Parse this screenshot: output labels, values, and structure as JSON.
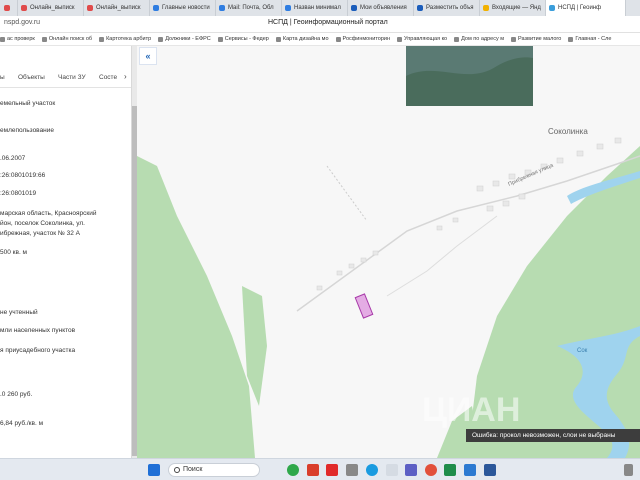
{
  "browser": {
    "tabs": [
      {
        "label": "",
        "color": "#e04b4b"
      },
      {
        "label": "Онлайн_выписк",
        "color": "#e04b4b"
      },
      {
        "label": "Онлайн_выписк",
        "color": "#e04b4b"
      },
      {
        "label": "Главные новости",
        "color": "#2f7de1"
      },
      {
        "label": "Mail: Почта, Обл",
        "color": "#2f7de1"
      },
      {
        "label": "Назван минимал",
        "color": "#2f7de1"
      },
      {
        "label": "Мои объявления",
        "color": "#1b5dbb"
      },
      {
        "label": "Разместить объя",
        "color": "#1b5dbb"
      },
      {
        "label": "Входящие — Янд",
        "color": "#f2b100"
      },
      {
        "label": "НСПД | Геоинф",
        "color": "#3b9edb",
        "active": true
      }
    ],
    "url": "nspd.gov.ru",
    "page_title": "НСПД | Геоинформационный портал",
    "bookmarks": [
      "ас проверк",
      "Онлайн поиск об",
      "Картотека арбитр",
      "Должники - ЕФРС",
      "Сервисы - Федер",
      "Карта дизайна мо",
      "Росфинмониторин",
      "Управляющая ко",
      "Дом по адресу м",
      "Развитие малого",
      "Главная - Сле"
    ]
  },
  "panel": {
    "tabs": [
      "ы",
      "Объекты",
      "Части ЗУ",
      "Состе"
    ],
    "more": "›",
    "rows": [
      {
        "text": "емельный участок"
      },
      {
        "text": "емлепользование"
      },
      {
        "text": ".06.2007"
      },
      {
        "text": ":26:0801019:66"
      },
      {
        "text": ":26:0801019"
      },
      {
        "text": "марская область, Красноярский"
      },
      {
        "text": "йон, поселок Соколинка, ул."
      },
      {
        "text": "ибрежная, участок № 32 А"
      },
      {
        "text": "500 кв. м"
      },
      {
        "text": "не учтенный"
      },
      {
        "text": "мли населенных пунктов"
      },
      {
        "text": "я приусадебного участка"
      },
      {
        "text": ".0 260 руб."
      },
      {
        "text": "6,84 руб./кв. м"
      }
    ]
  },
  "map": {
    "collapse_label": "«",
    "place_name": "Соколинка",
    "street_label": "Прибрежная улица",
    "river_label": "Сок",
    "watermark": "ЦИАН",
    "error_text": "Ошибка: прокол невозможен, слои не выбраны",
    "colors": {
      "forest": "#b7dcb1",
      "forest_dark": "#a8d3a2",
      "water": "#9fd3ee",
      "parcel": "#d56fd6",
      "road": "#ffffff"
    }
  },
  "taskbar": {
    "search_label": "Поиск"
  }
}
